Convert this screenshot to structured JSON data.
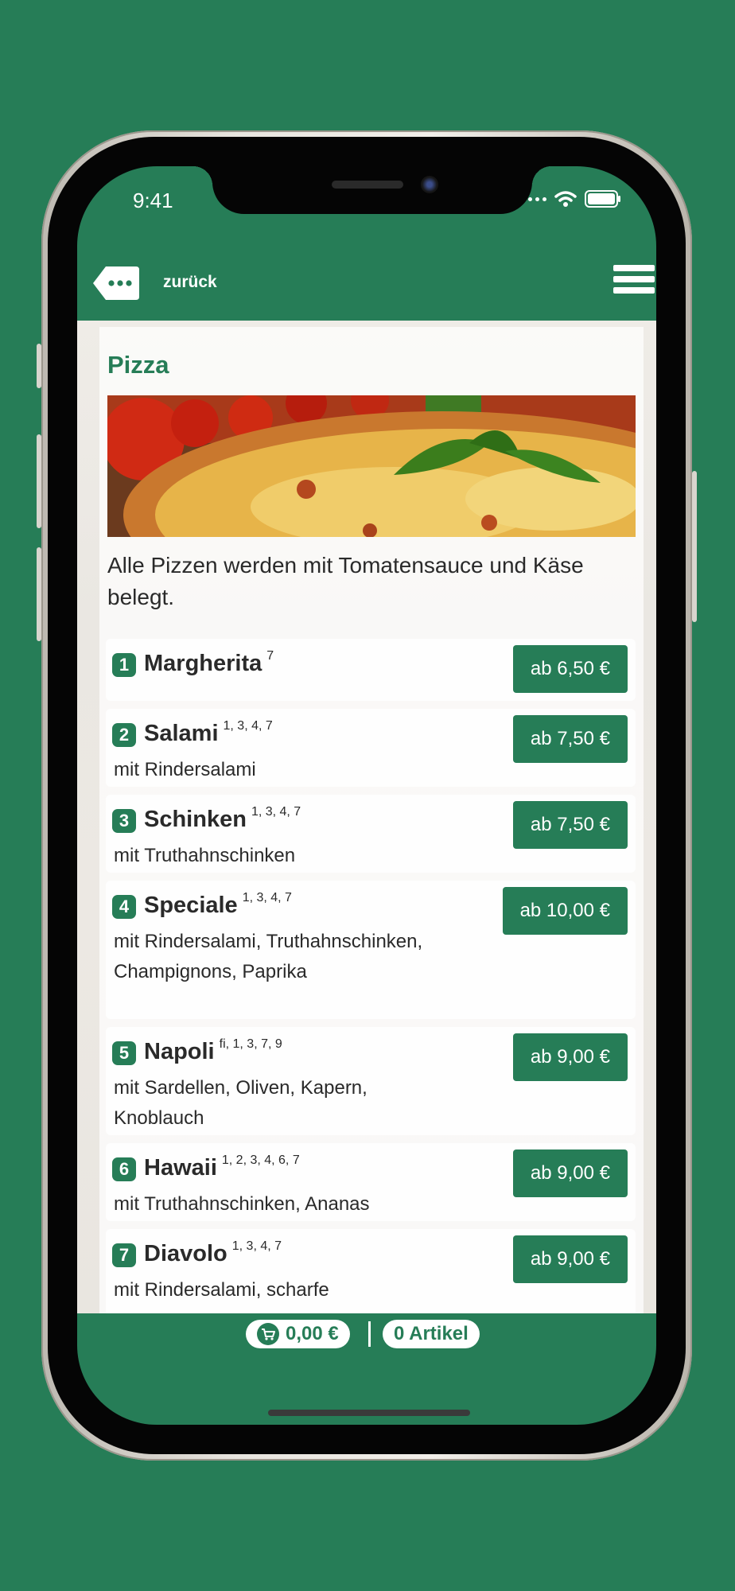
{
  "status_bar": {
    "time": "9:41"
  },
  "header": {
    "back_label": "zurück"
  },
  "category": {
    "title": "Pizza",
    "intro": "Alle Pizzen werden mit Tomatensauce und Käse belegt."
  },
  "items": [
    {
      "num": "1",
      "name": "Margherita",
      "sup": "7",
      "desc": "",
      "price": "ab 6,50 €"
    },
    {
      "num": "2",
      "name": "Salami",
      "sup": "1, 3, 4, 7",
      "desc": "mit Rindersalami",
      "price": "ab 7,50 €"
    },
    {
      "num": "3",
      "name": "Schinken",
      "sup": "1, 3, 4, 7",
      "desc": "mit Truthahnschinken",
      "price": "ab 7,50 €"
    },
    {
      "num": "4",
      "name": "Speciale",
      "sup": "1, 3, 4, 7",
      "desc": "mit Rindersalami, Truthahnschinken, Champignons, Paprika",
      "price": "ab 10,00 €"
    },
    {
      "num": "5",
      "name": "Napoli",
      "sup": "fi, 1, 3, 7, 9",
      "desc": "mit Sardellen, Oliven, Kapern, Knoblauch",
      "price": "ab 9,00 €"
    },
    {
      "num": "6",
      "name": "Hawaii",
      "sup": "1, 2, 3, 4, 6, 7",
      "desc": "mit Truthahnschinken, Ananas",
      "price": "ab 9,00 €"
    },
    {
      "num": "7",
      "name": "Diavolo",
      "sup": "1, 3, 4, 7",
      "desc": "mit Rindersalami, scharfe",
      "price": "ab 9,00 €"
    }
  ],
  "cart": {
    "total": "0,00 €",
    "count": "0 Artikel"
  },
  "colors": {
    "brand": "#267d57",
    "background": "#267d57"
  },
  "icons": [
    "back-dots-icon",
    "hamburger-menu-icon",
    "cart-icon",
    "wifi-icon",
    "battery-icon",
    "signal-dots-icon"
  ]
}
